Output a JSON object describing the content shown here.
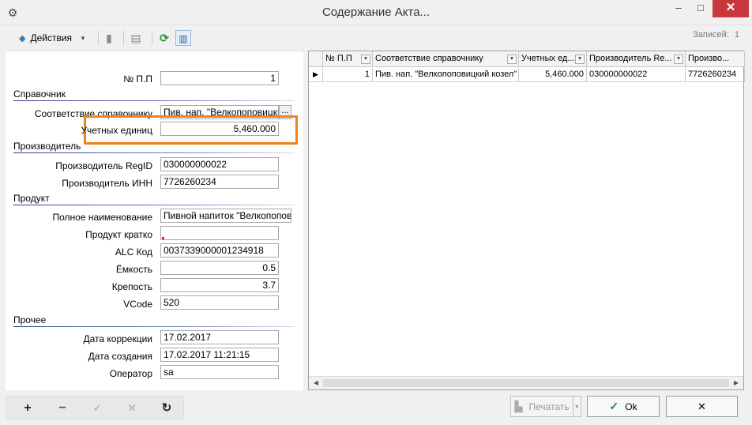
{
  "window": {
    "title": "Содержание Акта...",
    "minimize": "–",
    "maximize": "□",
    "close": "✕",
    "app_icon": "gear-icon"
  },
  "toolbar": {
    "actions_label": "Действия",
    "records_label": "Записей:",
    "records_count": "1"
  },
  "form": {
    "np_label": "№ П.П",
    "np_value": "1",
    "section_reference": "Справочник",
    "reference_label": "Соответствие справочнику",
    "reference_value": "Пив. нап. \"Велкопоповицкий",
    "ellipsis": "...",
    "units_label": "Учетных единиц",
    "units_value": "5,460.000",
    "section_producer": "Производитель",
    "producer_regid_label": "Производитель RegID",
    "producer_regid_value": "030000000022",
    "producer_inn_label": "Производитель ИНН",
    "producer_inn_value": "7726260234",
    "section_product": "Продукт",
    "full_name_label": "Полное наименование",
    "full_name_value": "Пивной напиток \"Велкопоповиц",
    "short_name_label": "Продукт кратко",
    "short_name_value": "",
    "alc_code_label": "ALC Код",
    "alc_code_value": "0037339000001234918",
    "capacity_label": "Ёмкость",
    "capacity_value": "0.5",
    "strength_label": "Крепость",
    "strength_value": "3.7",
    "vcode_label": "VCode",
    "vcode_value": "520",
    "section_other": "Прочее",
    "correction_date_label": "Дата коррекции",
    "correction_date_value": "17.02.2017",
    "creation_date_label": "Дата создания",
    "creation_date_value": "17.02.2017 11:21:15",
    "operator_label": "Оператор",
    "operator_value": "sa"
  },
  "grid": {
    "columns": [
      "№ П.П",
      "Соответствие справочнику",
      "Учетных ед...",
      "Производитель Re...",
      "Произво..."
    ],
    "rows": [
      [
        "1",
        "Пив. нап. \"Велкопоповицкий козел\"",
        "5,460.000",
        "030000000022",
        "7726260234"
      ]
    ],
    "row_marker": "▶"
  },
  "bottom": {
    "add": "+",
    "delete": "−",
    "confirm": "✓",
    "cancel": "✕",
    "reload": "↻",
    "print_label": "Печатать",
    "ok_label": "Ok",
    "close_label": "✕"
  }
}
